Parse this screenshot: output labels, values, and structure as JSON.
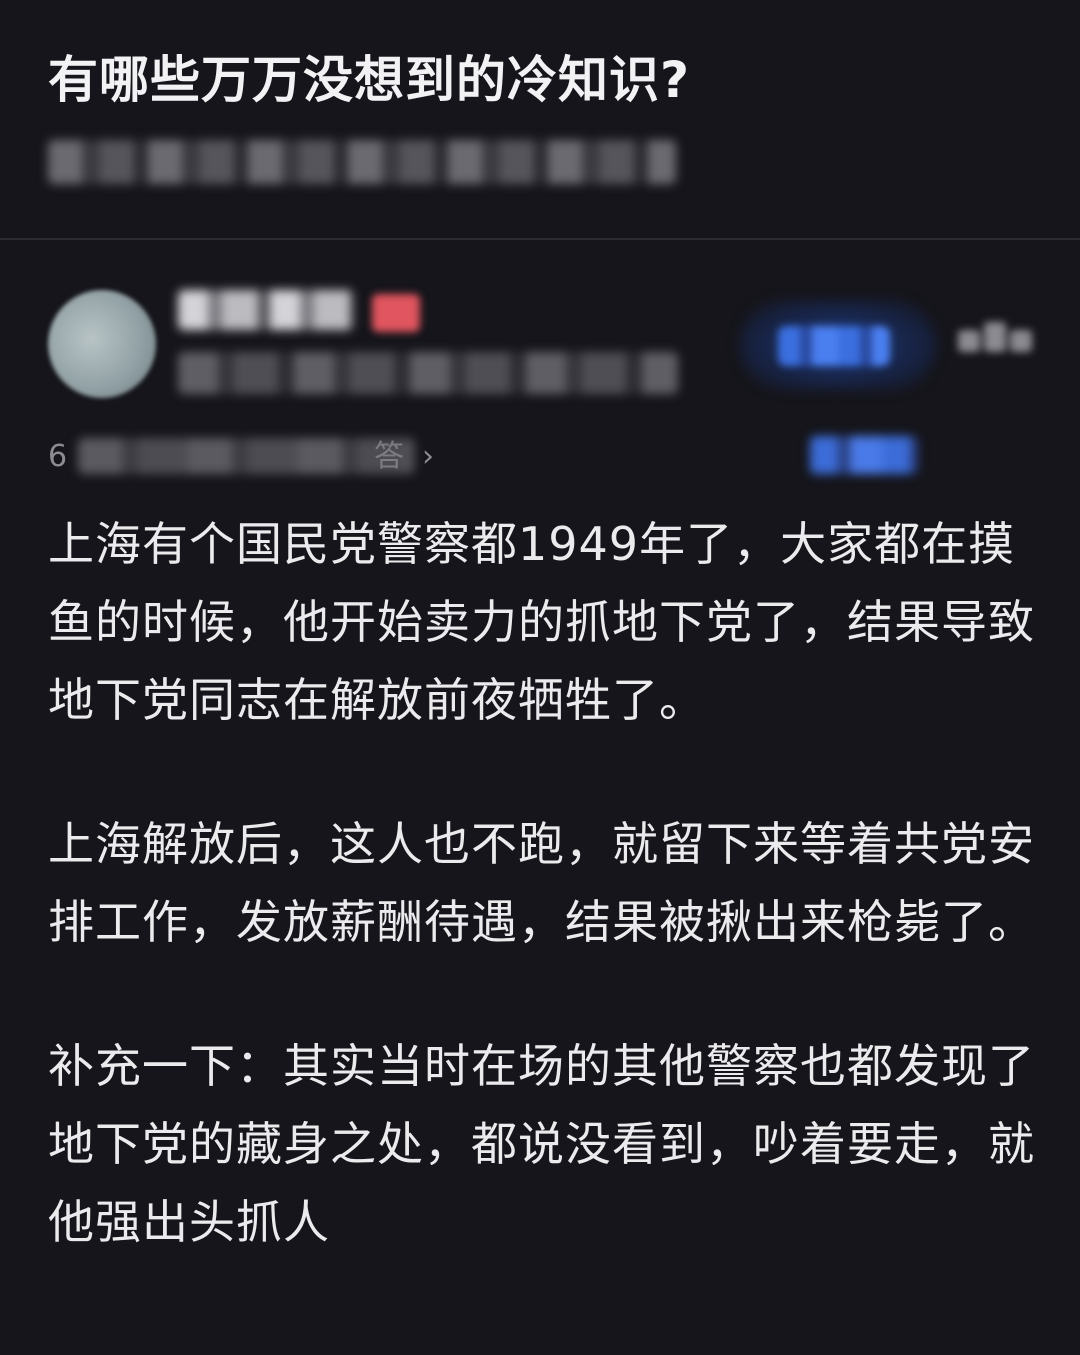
{
  "question": {
    "title": "有哪些万万没想到的冷知识?"
  },
  "author": {},
  "meta": {
    "lead_fragment": "6",
    "tail_fragment": "答"
  },
  "answer": {
    "paragraphs": [
      "上海有个国民党警察都1949年了，大家都在摸鱼的时候，他开始卖力的抓地下党了，结果导致地下党同志在解放前夜牺牲了。",
      "上海解放后，这人也不跑，就留下来等着共党安排工作，发放薪酬待遇，结果被揪出来枪毙了。",
      "补充一下：其实当时在场的其他警察也都发现了地下党的藏身之处，都说没看到，吵着要走，就他强出头抓人"
    ]
  }
}
